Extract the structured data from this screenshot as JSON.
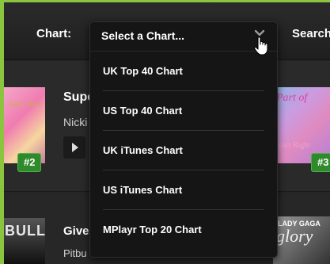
{
  "header": {
    "chart_label": "Chart:",
    "search_label": "Search"
  },
  "dropdown": {
    "selected": "Select a Chart...",
    "options": [
      "UK Top 40 Chart",
      "US Top 40 Chart",
      "UK iTunes Chart",
      "US iTunes Chart",
      "MPlayr Top 20 Chart"
    ]
  },
  "rows": [
    {
      "title": "Supe",
      "artist": "Nicki",
      "badge_left": "#2",
      "badge_right": "#3",
      "left_album_text": "Super Bass",
      "right_album_text": "Part of",
      "right_album_sub": "Heart Right",
      "icon": "play-icon"
    },
    {
      "title": "Give",
      "artist": "Pitbu",
      "left_album_text": "BULL",
      "right_album_sup": "LADY GAGA",
      "right_album_text": "glory"
    }
  ],
  "colors": {
    "accent_green": "#8bc43f",
    "badge_green": "#2f8a2c",
    "background": "#262626",
    "dropdown_bg": "#151515"
  }
}
